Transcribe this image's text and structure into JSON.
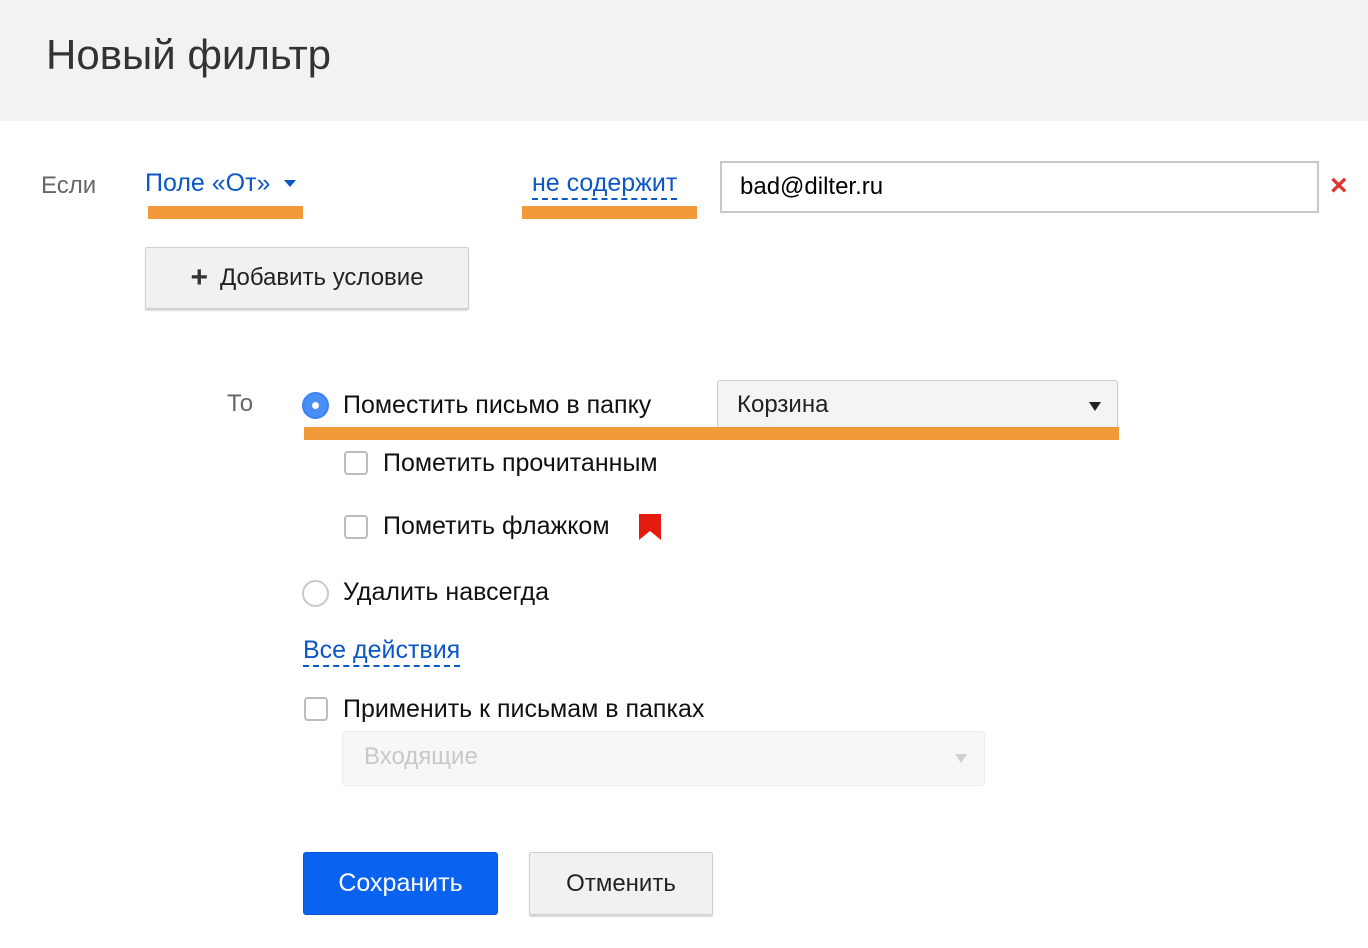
{
  "header": {
    "title": "Новый фильтр"
  },
  "condition": {
    "if_label": "Если",
    "field_label": "Поле «От»",
    "operator_label": "не содержит",
    "value": "bad@dilter.ru",
    "remove_symbol": "×",
    "add_condition_label": "Добавить условие",
    "add_symbol": "+"
  },
  "actions": {
    "then_label": "То",
    "move_to_folder_label": "Поместить письмо в папку",
    "folder_selected": "Корзина",
    "mark_read_label": "Пометить прочитанным",
    "mark_flag_label": "Пометить флажком",
    "delete_forever_label": "Удалить навсегда",
    "all_actions_label": "Все действия",
    "apply_to_folders_label": "Применить к письмам в папках",
    "apply_folder_placeholder": "Входящие"
  },
  "footer": {
    "save_label": "Сохранить",
    "cancel_label": "Отменить"
  },
  "colors": {
    "accent_blue": "#0a63f0",
    "link_blue": "#0c57c6",
    "highlight_orange": "#f29a3a",
    "flag_red": "#e31c0f",
    "remove_red": "#dd3333"
  },
  "icons": {
    "field_dropdown": "caret-down-icon",
    "remove": "close-icon",
    "add": "plus-icon",
    "flag": "flag-icon",
    "folder_dropdown": "caret-down-icon"
  }
}
